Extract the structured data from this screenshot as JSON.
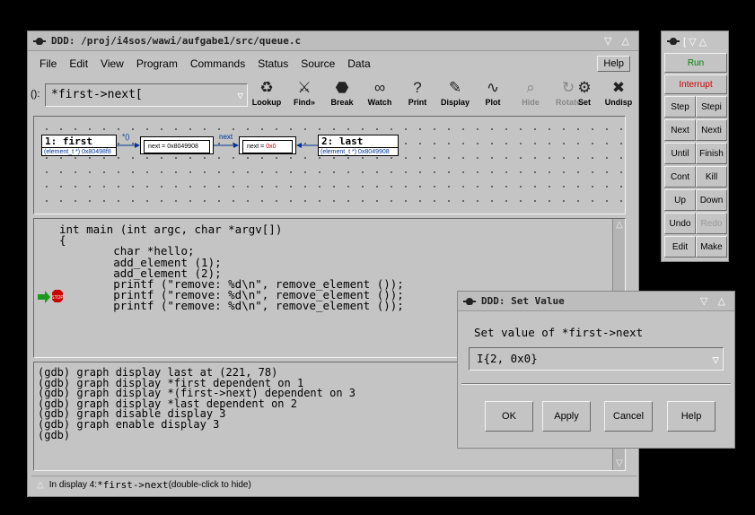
{
  "main_window": {
    "title": "DDD: /proj/i4sos/wawi/aufgabe1/src/queue.c",
    "controls": "▽ △"
  },
  "menubar": {
    "items": [
      "File",
      "Edit",
      "View",
      "Program",
      "Commands",
      "Status",
      "Source",
      "Data"
    ],
    "help": "Help"
  },
  "toolbar": {
    "arg_label": "():",
    "arg_value": "*first->next",
    "buttons": [
      {
        "label": "Lookup",
        "icon": "lookup-icon",
        "glyph": "♻"
      },
      {
        "label": "Find»",
        "icon": "find-icon",
        "glyph": "⚔"
      },
      {
        "label": "Break",
        "icon": "stop-sign-icon",
        "glyph": "⬣"
      },
      {
        "label": "Watch",
        "icon": "glasses-icon",
        "glyph": "∞"
      },
      {
        "label": "Print",
        "icon": "question-icon",
        "glyph": "?"
      },
      {
        "label": "Display",
        "icon": "pen-icon",
        "glyph": "✎"
      },
      {
        "label": "Plot",
        "icon": "plot-icon",
        "glyph": "∿"
      },
      {
        "label": "Hide",
        "icon": "magnifier-icon",
        "glyph": "⌕"
      },
      {
        "label": "Rotate",
        "icon": "rotate-icon",
        "glyph": "↻"
      },
      {
        "label": "Set",
        "icon": "set-icon",
        "glyph": "⚙"
      },
      {
        "label": "Undisp",
        "icon": "undisplay-icon",
        "glyph": "✖"
      }
    ]
  },
  "graph": {
    "node1": {
      "title": "1: first",
      "value": "(element_t *) 0x80498f8"
    },
    "node2": {
      "value": "next = 0x8049908"
    },
    "node3": {
      "value_prefix": "next = ",
      "value_red": "0x0"
    },
    "node4": {
      "title": "2: last",
      "value": "(element_t *) 0x8049908"
    },
    "edge_labels": [
      "*()",
      "next"
    ]
  },
  "source": {
    "lines": "int main (int argc, char *argv[])\n{\n        char *hello;\n        add_element (1);\n        add_element (2);\n        printf (\"remove: %d\\n\", remove_element ());\n        printf (\"remove: %d\\n\", remove_element ());\n        printf (\"remove: %d\\n\", remove_element ());",
    "stop_label": "STOP"
  },
  "console": {
    "lines": "(gdb) graph display last at (221, 78)\n(gdb) graph display *first dependent on 1\n(gdb) graph display *(first->next) dependent on 3\n(gdb) graph display *last dependent on 2\n(gdb) graph disable display 3\n(gdb) graph enable display 3\n(gdb)"
  },
  "status": {
    "prefix": "In display 4: ",
    "expr": "*first->next",
    "suffix": " (double-click to hide)"
  },
  "command_tool": {
    "title": "[ ▽ △",
    "run": "Run",
    "interrupt": "Interrupt",
    "buttons": [
      [
        "Step",
        "Stepi"
      ],
      [
        "Next",
        "Nexti"
      ],
      [
        "Until",
        "Finish"
      ],
      [
        "Cont",
        "Kill"
      ],
      [
        "Up",
        "Down"
      ],
      [
        "Undo",
        "Redo"
      ],
      [
        "Edit",
        "Make"
      ]
    ]
  },
  "dialog": {
    "title": "DDD: Set Value",
    "controls": "▽ △",
    "message": "Set value of *first->next",
    "value": "{2, 0x0}",
    "buttons": [
      "OK",
      "Apply",
      "Cancel",
      "Help"
    ]
  },
  "colors": {
    "window_bg": "#c4c4c4",
    "run_text": "#008000",
    "interrupt_text": "#cc0000",
    "value_blue": "#003399",
    "stop_red": "#cc0000",
    "arrow_green": "#1a9a1a"
  }
}
